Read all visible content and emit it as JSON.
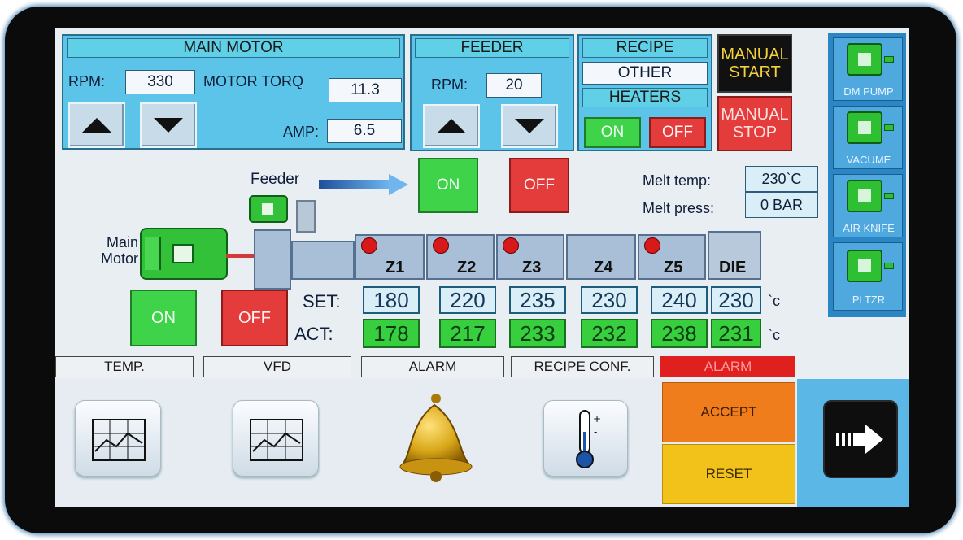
{
  "main_motor": {
    "title": "MAIN MOTOR",
    "rpm_label": "RPM:",
    "rpm_value": "330",
    "torque_label": "MOTOR TORQ",
    "torque_value": "11.3",
    "amp_label": "AMP:",
    "amp_value": "6.5"
  },
  "feeder": {
    "title": "FEEDER",
    "rpm_label": "RPM:",
    "rpm_value": "20"
  },
  "recipe": {
    "title": "RECIPE",
    "value": "OTHER",
    "heaters_label": "HEATERS",
    "heaters_on": "ON",
    "heaters_off": "OFF"
  },
  "manual": {
    "start": "MANUAL START",
    "stop": "MANUAL STOP"
  },
  "side_buttons": [
    "DM PUMP",
    "VACUME",
    "AIR KNIFE",
    "PLTZR"
  ],
  "process": {
    "feeder_label": "Feeder",
    "feeder_on": "ON",
    "feeder_off": "OFF",
    "melt_temp_label": "Melt temp:",
    "melt_temp_value": "230`C",
    "melt_press_label": "Melt press:",
    "melt_press_value": "0 BAR",
    "main_motor_label": "Main Motor",
    "motor_on": "ON",
    "motor_off": "OFF",
    "set_label": "SET:",
    "act_label": "ACT:",
    "unit": "`c",
    "zones": [
      {
        "name": "Z1",
        "set": "180",
        "act": "178",
        "heater": true
      },
      {
        "name": "Z2",
        "set": "220",
        "act": "217",
        "heater": true
      },
      {
        "name": "Z3",
        "set": "235",
        "act": "233",
        "heater": true
      },
      {
        "name": "Z4",
        "set": "230",
        "act": "232",
        "heater": false
      },
      {
        "name": "Z5",
        "set": "240",
        "act": "238",
        "heater": true
      },
      {
        "name": "DIE",
        "set": "230",
        "act": "231",
        "heater": false
      }
    ]
  },
  "tabs": [
    "TEMP.",
    "VFD",
    "ALARM",
    "RECIPE CONF."
  ],
  "alarm": {
    "banner": "ALARM",
    "accept": "ACCEPT",
    "reset": "RESET"
  },
  "colors": {
    "panel": "#5bc4e8",
    "on_green": "#3fd34a",
    "off_red": "#e43b3b",
    "accept_orange": "#f07d1c",
    "reset_yellow": "#f2c21b",
    "manual_start_bg": "#111111",
    "manual_start_text": "#f3d23a"
  }
}
